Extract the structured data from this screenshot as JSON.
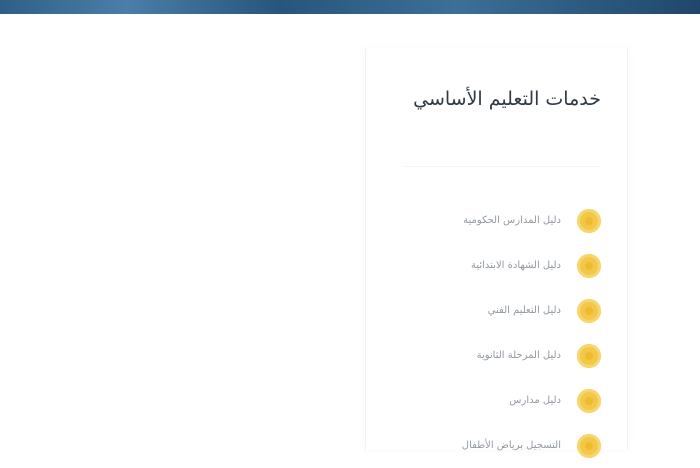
{
  "section": {
    "title": "خدمات التعليم الأساسي"
  },
  "services": {
    "items": [
      {
        "label": "دليل المدارس الحكومية"
      },
      {
        "label": "دليل الشهادة الابتدائية"
      },
      {
        "label": "دليل التعليم الفني"
      },
      {
        "label": "دليل المرحلة الثانوية"
      },
      {
        "label": "دليل مدارس"
      },
      {
        "label": "التسجيل برياض الأطفال"
      }
    ]
  },
  "colors": {
    "top_band": "#2f5f86",
    "bullet": "#f3c74a",
    "title_text": "#2f3a45",
    "item_text": "#9299a1"
  }
}
